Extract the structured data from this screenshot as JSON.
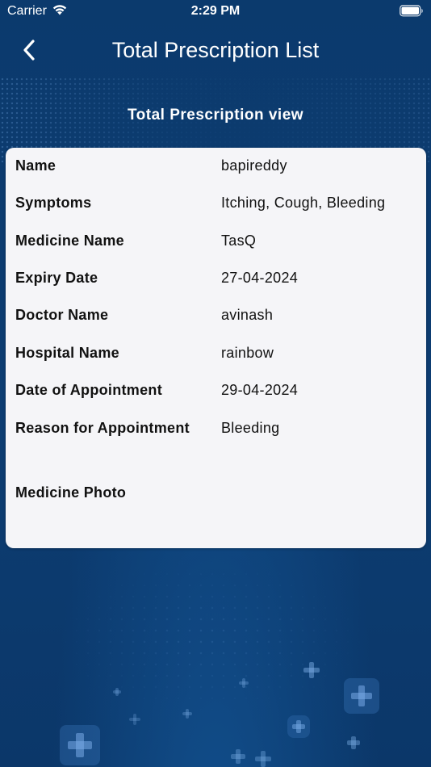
{
  "status_bar": {
    "carrier": "Carrier",
    "time": "2:29 PM"
  },
  "nav": {
    "title": "Total Prescription List",
    "back_icon": "chevron-left-icon"
  },
  "section_title": "Total Prescription view",
  "details": {
    "name_label": "Name",
    "name_value": "bapireddy",
    "symptoms_label": "Symptoms",
    "symptoms_value": "Itching, Cough, Bleeding",
    "medicine_label": "Medicine Name",
    "medicine_value": "TasQ",
    "expiry_label": "Expiry Date",
    "expiry_value": "27-04-2024",
    "doctor_label": "Doctor Name",
    "doctor_value": "avinash",
    "hospital_label": "Hospital Name",
    "hospital_value": "rainbow",
    "appointment_date_label": "Date of Appointment",
    "appointment_date_value": "29-04-2024",
    "reason_label": "Reason for Appointment",
    "reason_value": "Bleeding",
    "photo_label": "Medicine Photo"
  },
  "colors": {
    "background": "#0c3a6e",
    "card": "#f5f5f8",
    "text_light": "#ffffff",
    "text_dark": "#111111"
  }
}
